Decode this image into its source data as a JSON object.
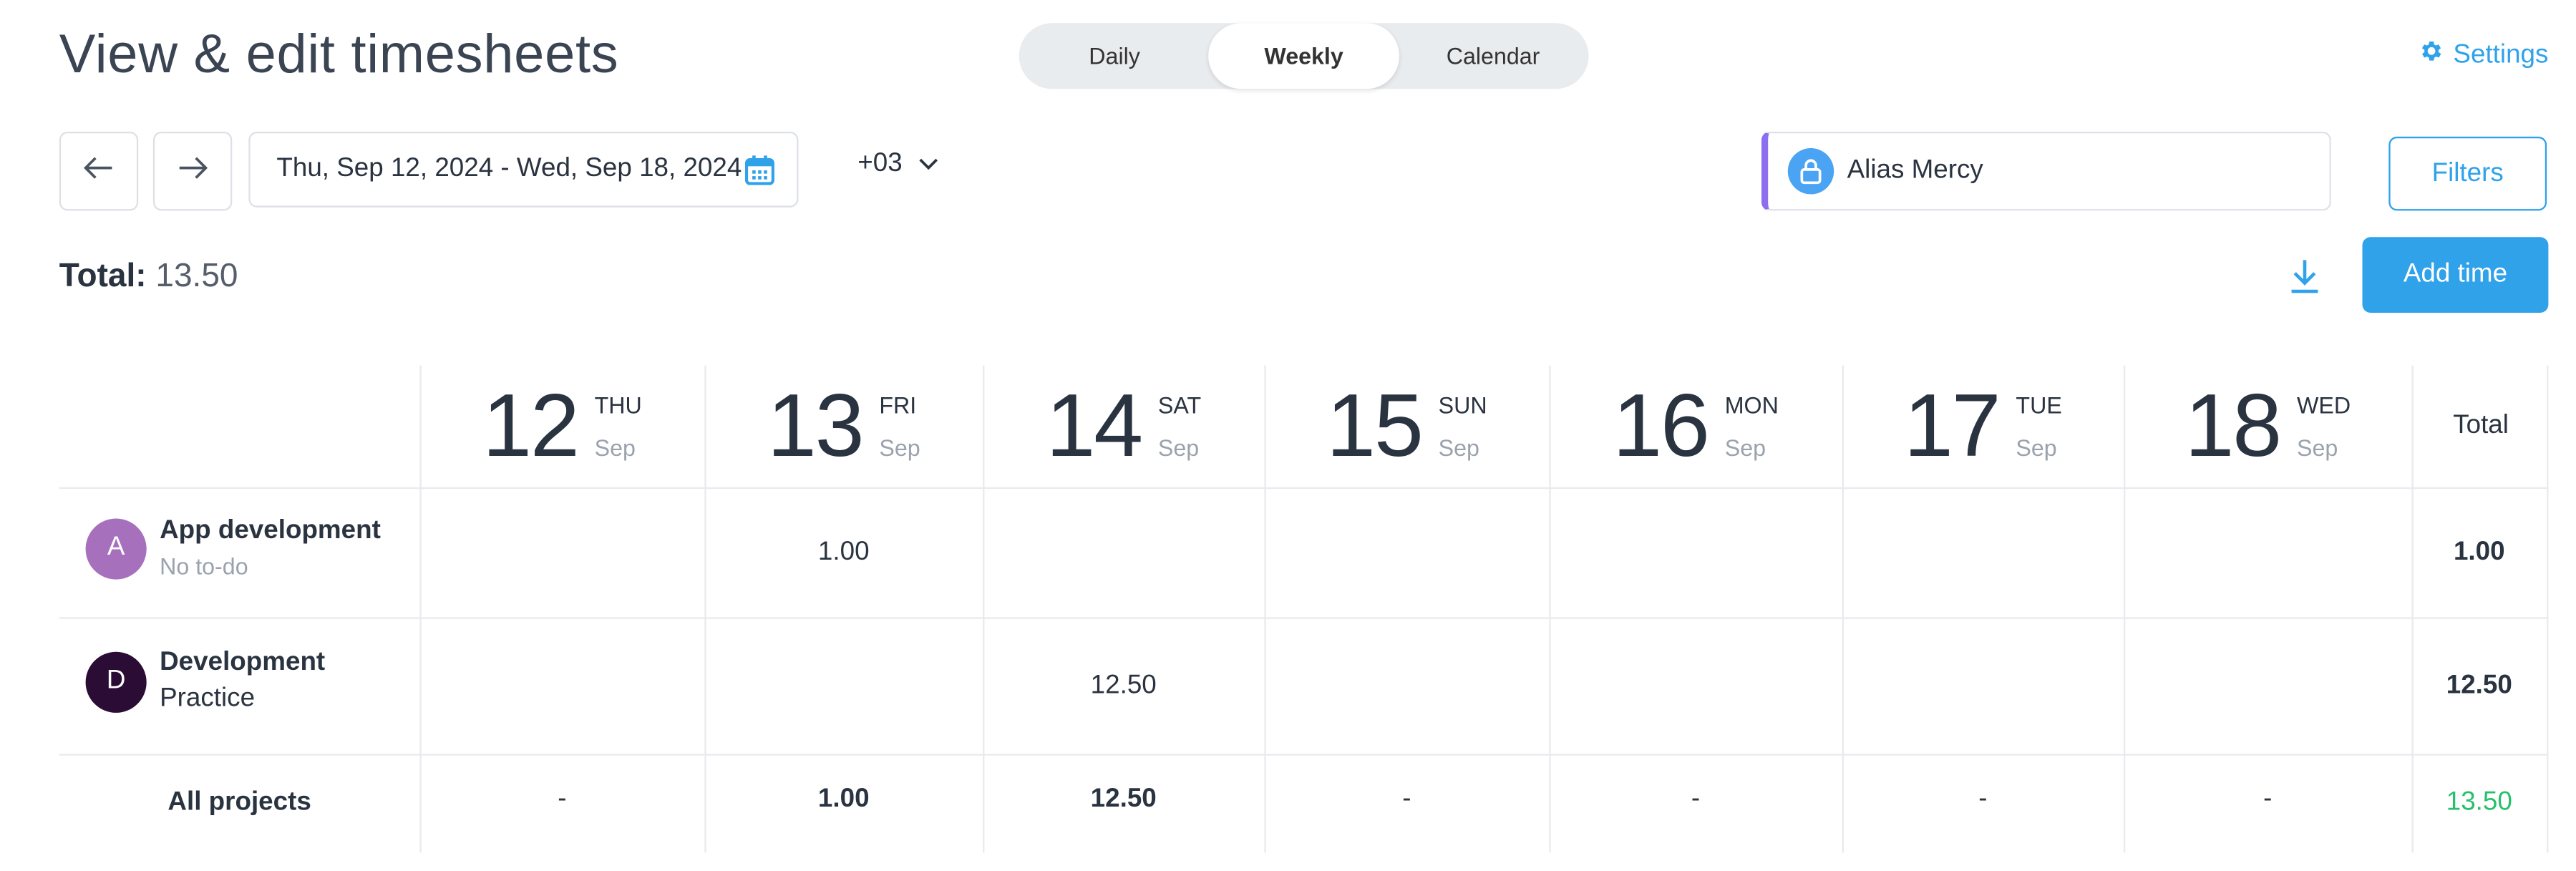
{
  "header": {
    "title": "View & edit timesheets",
    "views": [
      "Daily",
      "Weekly",
      "Calendar"
    ],
    "active_view": "Weekly",
    "settings_label": "Settings"
  },
  "toolbar": {
    "date_range": "Thu, Sep 12, 2024 - Wed, Sep 18, 2024",
    "timezone": "+03",
    "user": "Alias Mercy",
    "filters_label": "Filters"
  },
  "summary": {
    "total_label": "Total:",
    "total_value": "13.50",
    "add_time_label": "Add time"
  },
  "table": {
    "days": [
      {
        "num": "12",
        "dow": "THU",
        "mon": "Sep"
      },
      {
        "num": "13",
        "dow": "FRI",
        "mon": "Sep"
      },
      {
        "num": "14",
        "dow": "SAT",
        "mon": "Sep"
      },
      {
        "num": "15",
        "dow": "SUN",
        "mon": "Sep"
      },
      {
        "num": "16",
        "dow": "MON",
        "mon": "Sep"
      },
      {
        "num": "17",
        "dow": "TUE",
        "mon": "Sep"
      },
      {
        "num": "18",
        "dow": "WED",
        "mon": "Sep"
      }
    ],
    "total_header": "Total",
    "rows": [
      {
        "avatar": "A",
        "name": "App development",
        "sub": "No to-do",
        "values": [
          "",
          "1.00",
          "",
          "",
          "",
          "",
          ""
        ],
        "total": "1.00"
      },
      {
        "avatar": "D",
        "name": "Development",
        "sub": "Practice",
        "values": [
          "",
          "",
          "12.50",
          "",
          "",
          "",
          ""
        ],
        "total": "12.50"
      }
    ],
    "footer": {
      "label": "All projects",
      "values": [
        "-",
        "1.00",
        "12.50",
        "-",
        "-",
        "-",
        "-"
      ],
      "total": "13.50"
    }
  },
  "colors": {
    "accent": "#2fa2ea",
    "avatar_a": "#a770bd",
    "avatar_d": "#2b0c35",
    "grand_total": "#27c06a",
    "user_border": "#8b6ff0"
  }
}
